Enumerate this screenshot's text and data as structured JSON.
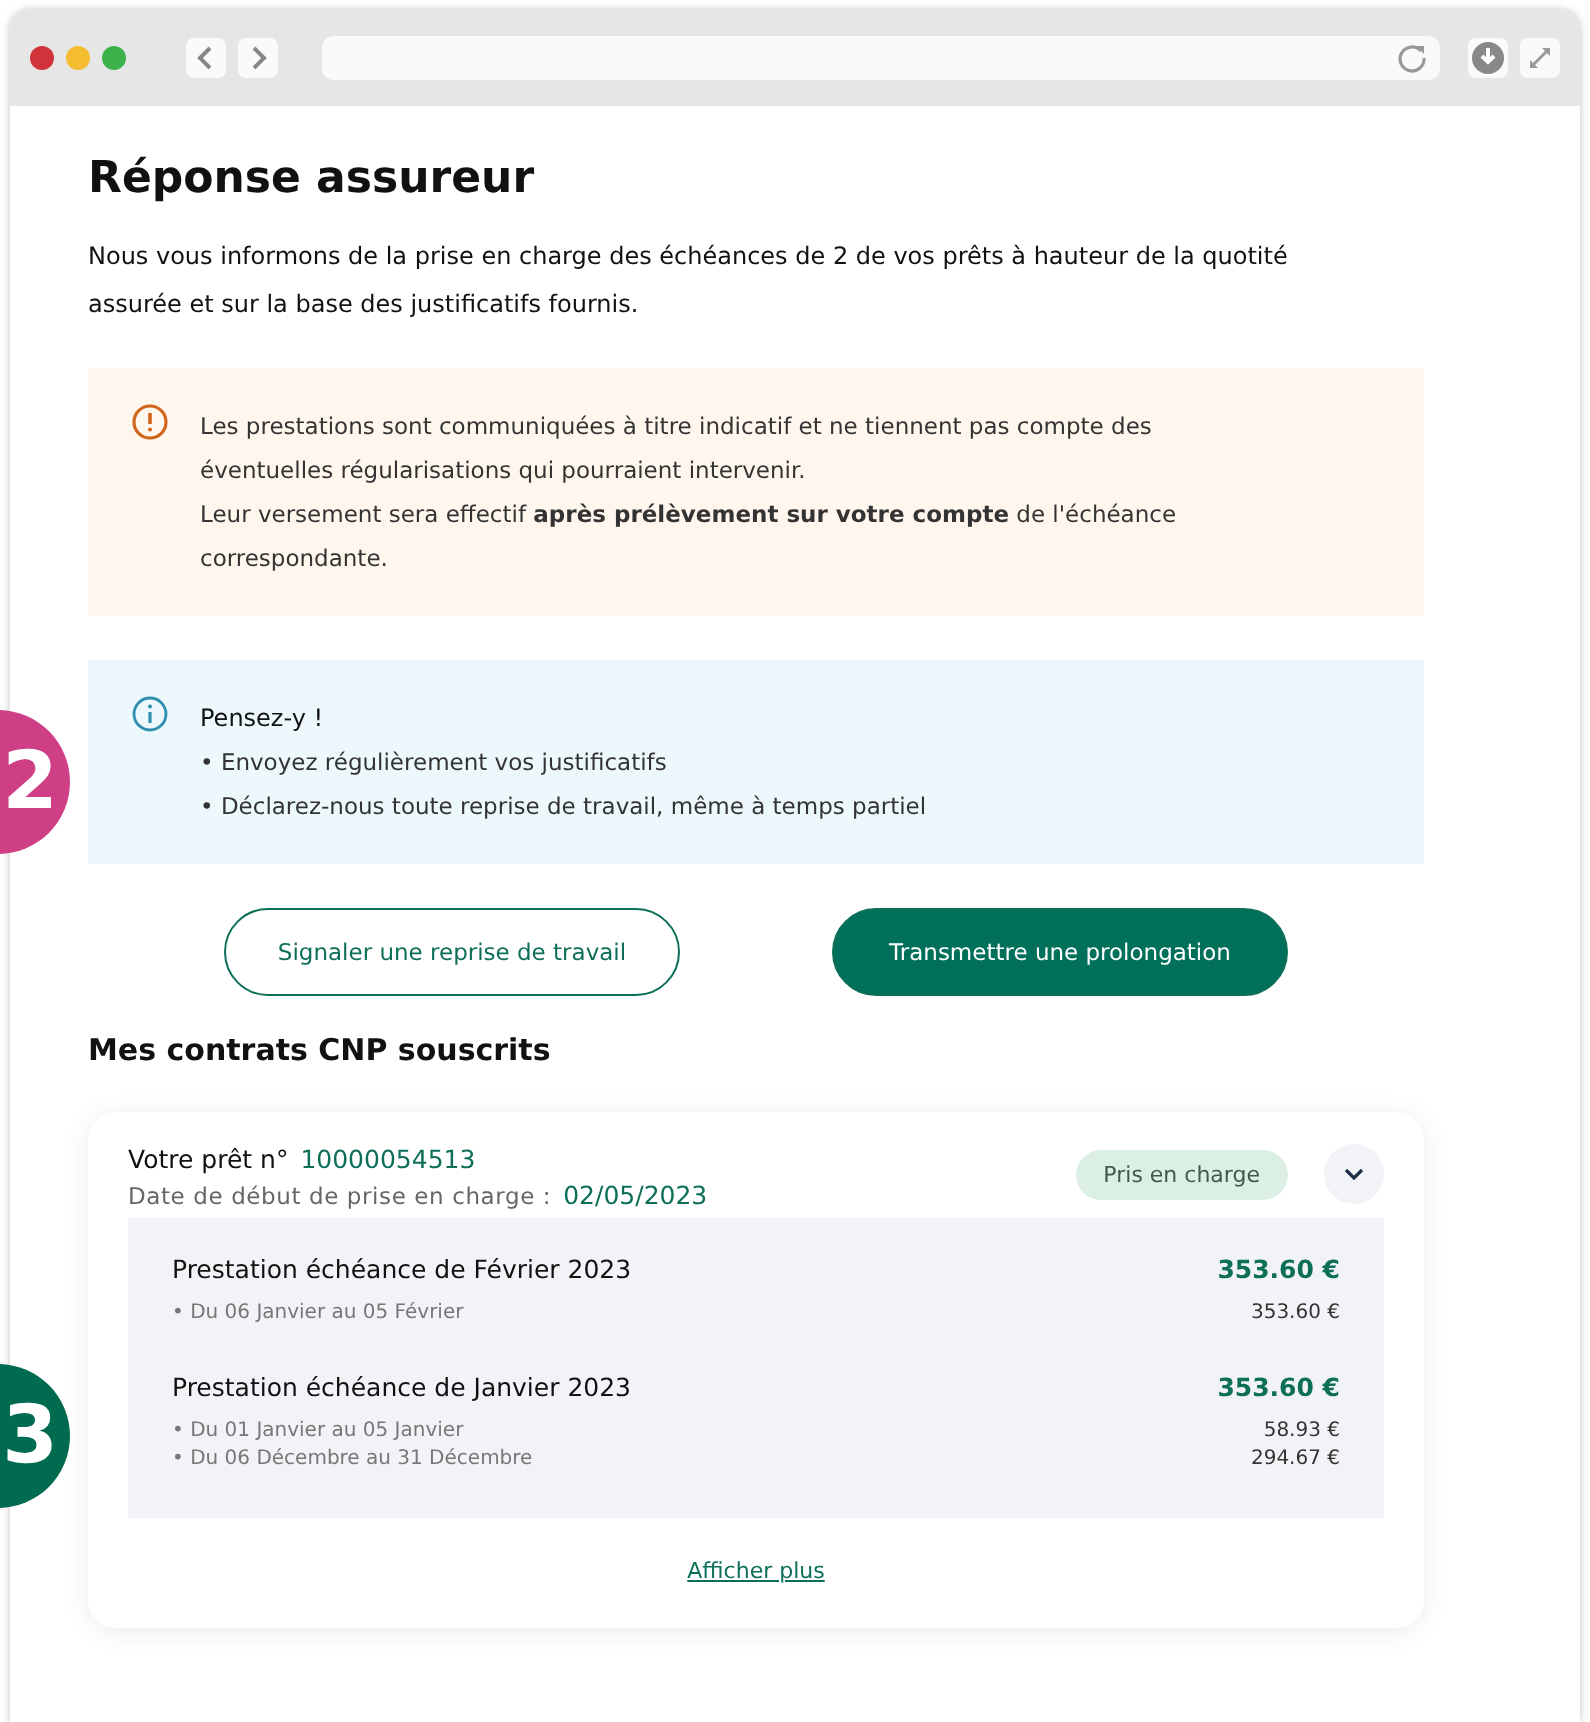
{
  "markers": [
    {
      "label": "2",
      "color": "#cf3f86"
    },
    {
      "label": "3",
      "color": "#006b4f"
    }
  ],
  "page": {
    "title": "Réponse assureur",
    "intro": "Nous vous informons de la prise en charge des échéances de 2 de vos prêts à hauteur de la quotité assurée et sur la base des justificatifs fournis."
  },
  "notices": [
    {
      "kind": "warning",
      "lines": [
        "Les prestations sont communiquées à titre indicatif et ne tiennent pas compte des éventuelles régularisations qui pourraient intervenir.",
        "Leur versement sera effectif **après prélèvement sur votre compte** de l'échéance correspondante."
      ]
    },
    {
      "kind": "info",
      "title": "Pensez-y !",
      "lines": [
        "• Envoyez régulièrement vos justificatifs",
        "• Déclarez-nous toute reprise de travail, même à temps partiel"
      ]
    }
  ],
  "actions": [
    {
      "label": "Signaler une reprise de travail",
      "kind": "outline"
    },
    {
      "label": "Transmettre une prolongation",
      "kind": "filled"
    }
  ],
  "contracts": {
    "heading": "Mes contrats CNP souscrits",
    "items": [
      {
        "loan_label": "Votre prêt n°",
        "loan_number": "10000054513",
        "start_label": "Date de début de prise en charge :",
        "start_date": "02/05/2023",
        "status": "Pris en charge",
        "expanded": true,
        "benefits": [
          {
            "title": "Prestation échéance de Février 2023",
            "amount": "353.60 €",
            "periods": [
              {
                "label": "• Du 06 Janvier au 05 Février",
                "amount": "353.60 €"
              }
            ]
          },
          {
            "title": "Prestation échéance de Janvier 2023",
            "amount": "353.60 €",
            "periods": [
              {
                "label": "• Du 01 Janvier au 05 Janvier",
                "amount": "58.93 €"
              },
              {
                "label": "• Du 06 Décembre au 31 Décembre",
                "amount": "294.67 €"
              }
            ]
          }
        ],
        "more_link": "Afficher plus"
      }
    ]
  }
}
